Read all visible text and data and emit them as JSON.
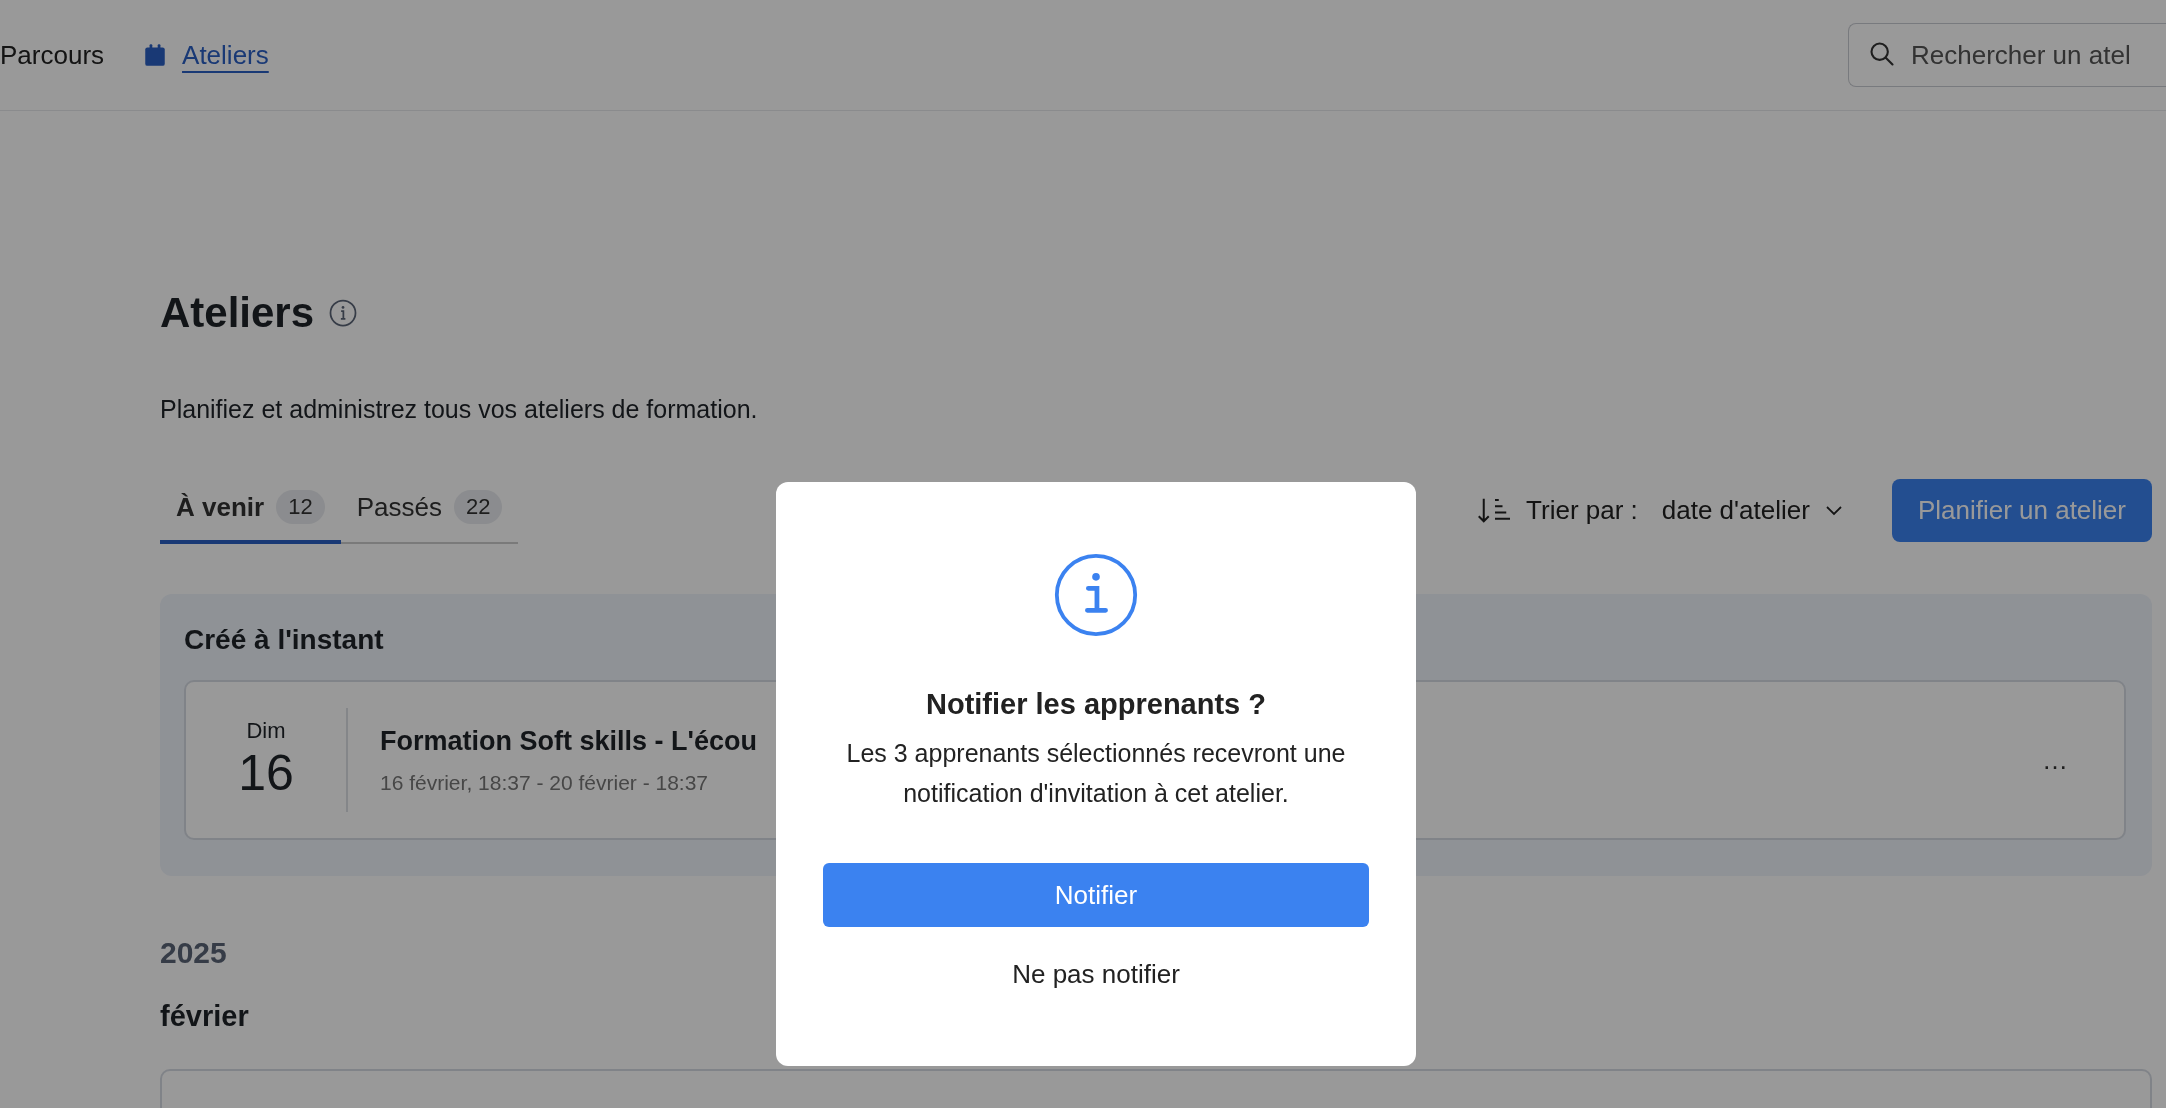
{
  "nav": {
    "items": [
      {
        "label": "Parcours",
        "selected": false
      },
      {
        "label": "Ateliers",
        "selected": true
      }
    ],
    "search": {
      "placeholder": "Rechercher un atel"
    }
  },
  "page": {
    "title": "Ateliers",
    "description": "Planifiez et administrez tous vos ateliers de formation."
  },
  "tabs": [
    {
      "label": "À venir",
      "count": "12",
      "selected": true
    },
    {
      "label": "Passés",
      "count": "22",
      "selected": false
    }
  ],
  "sort": {
    "label": "Trier par :",
    "value": "date d'atelier"
  },
  "primary_button": "Planifier un atelier",
  "recent": {
    "title": "Créé à l'instant",
    "event": {
      "weekday": "Dim",
      "day": "16",
      "title": "Formation Soft skills - L'écou",
      "dates": "16 février, 18:37 - 20 février - 18:37",
      "menu": "…"
    }
  },
  "year": "2025",
  "month": "février",
  "dialog": {
    "title": "Notifier les apprenants ?",
    "message": "Les 3 apprenants sélectionnés recevront une notification d'invitation à cet atelier.",
    "confirm": "Notifier",
    "cancel": "Ne pas notifier"
  }
}
